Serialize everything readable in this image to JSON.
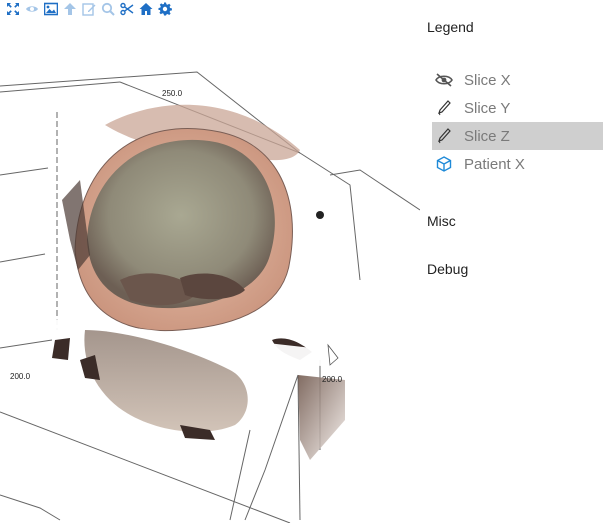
{
  "toolbar": {
    "buttons": [
      {
        "name": "fullscreen",
        "icon": "expand-icon",
        "enabled": true
      },
      {
        "name": "visibility",
        "icon": "eye-icon",
        "enabled": false
      },
      {
        "name": "screenshot",
        "icon": "image-icon",
        "enabled": true
      },
      {
        "name": "up",
        "icon": "arrow-up-icon",
        "enabled": false
      },
      {
        "name": "edit",
        "icon": "edit-icon",
        "enabled": false
      },
      {
        "name": "zoom",
        "icon": "zoom-icon",
        "enabled": false
      },
      {
        "name": "cut",
        "icon": "scissors-icon",
        "enabled": true
      },
      {
        "name": "home",
        "icon": "home-icon",
        "enabled": true
      },
      {
        "name": "settings",
        "icon": "gear-icon",
        "enabled": true
      }
    ],
    "accent_color": "#1f6fc5"
  },
  "viewport": {
    "axis_ticks": [
      "250.0",
      "200.0",
      "200.0"
    ]
  },
  "panel": {
    "legend_title": "Legend",
    "legend_items": [
      {
        "label": "Slice X",
        "icon": "eye-off-icon",
        "selected": false
      },
      {
        "label": "Slice Y",
        "icon": "pen-icon",
        "selected": false
      },
      {
        "label": "Slice Z",
        "icon": "pen-icon",
        "selected": true
      },
      {
        "label": "Patient X",
        "icon": "cube-icon",
        "selected": false
      }
    ],
    "misc_title": "Misc",
    "debug_title": "Debug"
  }
}
